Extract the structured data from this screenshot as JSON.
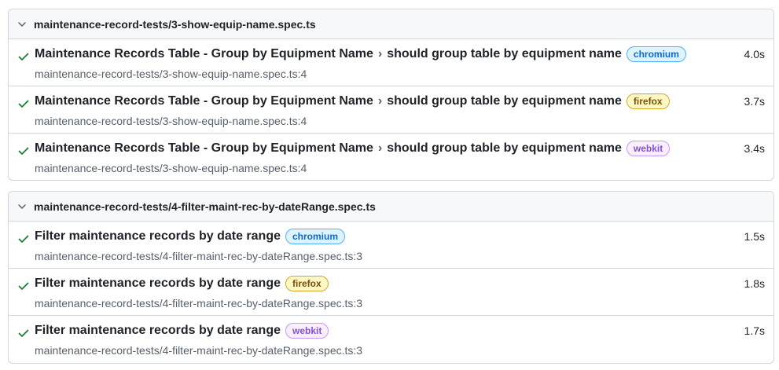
{
  "files": [
    {
      "name": "maintenance-record-tests/3-show-equip-name.spec.ts",
      "tests": [
        {
          "suite": "Maintenance Records Table - Group by Equipment Name",
          "separator": "›",
          "title": "should group table by equipment name",
          "project": "chromium",
          "duration": "4.0s",
          "location": "maintenance-record-tests/3-show-equip-name.spec.ts:4"
        },
        {
          "suite": "Maintenance Records Table - Group by Equipment Name",
          "separator": "›",
          "title": "should group table by equipment name",
          "project": "firefox",
          "duration": "3.7s",
          "location": "maintenance-record-tests/3-show-equip-name.spec.ts:4"
        },
        {
          "suite": "Maintenance Records Table - Group by Equipment Name",
          "separator": "›",
          "title": "should group table by equipment name",
          "project": "webkit",
          "duration": "3.4s",
          "location": "maintenance-record-tests/3-show-equip-name.spec.ts:4"
        }
      ]
    },
    {
      "name": "maintenance-record-tests/4-filter-maint-rec-by-dateRange.spec.ts",
      "tests": [
        {
          "suite": "",
          "separator": "",
          "title": "Filter maintenance records by date range",
          "project": "chromium",
          "duration": "1.5s",
          "location": "maintenance-record-tests/4-filter-maint-rec-by-dateRange.spec.ts:3"
        },
        {
          "suite": "",
          "separator": "",
          "title": "Filter maintenance records by date range",
          "project": "firefox",
          "duration": "1.8s",
          "location": "maintenance-record-tests/4-filter-maint-rec-by-dateRange.spec.ts:3"
        },
        {
          "suite": "",
          "separator": "",
          "title": "Filter maintenance records by date range",
          "project": "webkit",
          "duration": "1.7s",
          "location": "maintenance-record-tests/4-filter-maint-rec-by-dateRange.spec.ts:3"
        }
      ]
    }
  ],
  "icons": {
    "expand": "chevron-down-icon",
    "status": "check-icon"
  },
  "colors": {
    "passed": "#1a7f37",
    "chromium": "#0969da",
    "firefox": "#7d4e00",
    "webkit": "#8250df",
    "border": "#d0d7de"
  }
}
